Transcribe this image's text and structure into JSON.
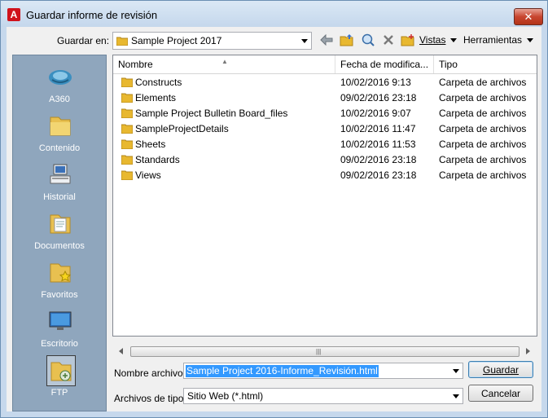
{
  "window": {
    "title": "Guardar informe de revisión",
    "close_label": "✕"
  },
  "toolbar": {
    "save_in_label": "Guardar en:",
    "save_in_value": "Sample Project 2017",
    "views_label": "Vistas",
    "tools_label": "Herramientas"
  },
  "places": [
    {
      "label": "A360",
      "icon": "a360-icon"
    },
    {
      "label": "Contenido",
      "icon": "folder-icon"
    },
    {
      "label": "Historial",
      "icon": "history-icon"
    },
    {
      "label": "Documentos",
      "icon": "documents-icon"
    },
    {
      "label": "Favoritos",
      "icon": "favorites-icon"
    },
    {
      "label": "Escritorio",
      "icon": "desktop-icon"
    },
    {
      "label": "FTP",
      "icon": "ftp-icon"
    }
  ],
  "columns": {
    "name": "Nombre",
    "date": "Fecha de modifica...",
    "type": "Tipo"
  },
  "files": [
    {
      "name": "Constructs",
      "date": "10/02/2016 9:13",
      "type": "Carpeta de archivos"
    },
    {
      "name": "Elements",
      "date": "09/02/2016 23:18",
      "type": "Carpeta de archivos"
    },
    {
      "name": "Sample Project Bulletin Board_files",
      "date": "10/02/2016 9:07",
      "type": "Carpeta de archivos"
    },
    {
      "name": "SampleProjectDetails",
      "date": "10/02/2016 11:47",
      "type": "Carpeta de archivos"
    },
    {
      "name": "Sheets",
      "date": "10/02/2016 11:53",
      "type": "Carpeta de archivos"
    },
    {
      "name": "Standards",
      "date": "09/02/2016 23:18",
      "type": "Carpeta de archivos"
    },
    {
      "name": "Views",
      "date": "09/02/2016 23:18",
      "type": "Carpeta de archivos"
    }
  ],
  "form": {
    "filename_label": "Nombre archivo:",
    "filename_value": "Sample Project 2016-Informe_Revisión.html",
    "filetype_label": "Archivos de tipo:",
    "filetype_value": "Sitio Web (*.html)",
    "save_button": "Guardar",
    "cancel_button": "Cancelar"
  }
}
